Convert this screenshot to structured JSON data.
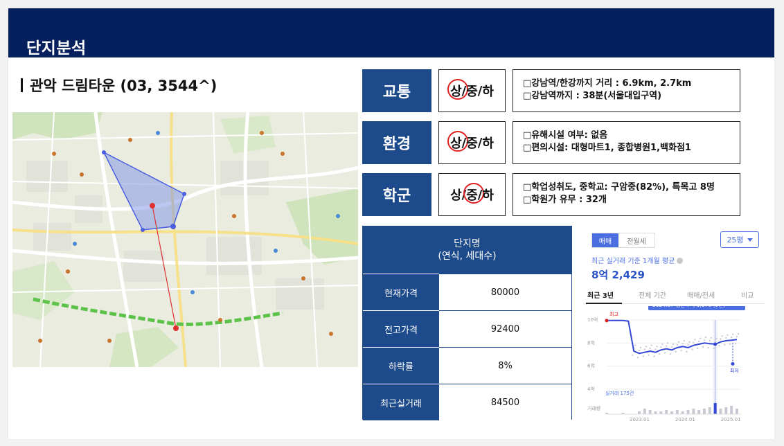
{
  "header": {
    "title": "단지분석"
  },
  "complex": {
    "title": "관악 드림타운 (03, 3544^)"
  },
  "analysis": [
    {
      "label": "교통",
      "grade": [
        "상",
        "/",
        "중",
        "/",
        "하"
      ],
      "selected": "상",
      "desc": [
        "□강남역/한강까지 거리 : 6.9km, 2.7km",
        "□강남역까지 : 38분(서울대입구역)"
      ]
    },
    {
      "label": "환경",
      "grade": [
        "상",
        "/",
        "중",
        "/",
        "하"
      ],
      "selected": "상",
      "desc": [
        "□유해시설 여부: 없음",
        "□편의시설: 대형마트1, 종합병원1,백화점1"
      ]
    },
    {
      "label": "학군",
      "grade": [
        "상",
        "/",
        "중",
        "/",
        "하"
      ],
      "selected": "중",
      "desc": [
        "□학업성취도, 중학교: 구암중(82%), 특목고 8명",
        "□학원가 유무 : 32개"
      ]
    }
  ],
  "table": {
    "header_line1": "단지명",
    "header_line2": "(연식, 세대수)",
    "rows": [
      {
        "key": "현재가격",
        "value": "80000"
      },
      {
        "key": "전고가격",
        "value": "92400"
      },
      {
        "key": "하락률",
        "value": "8%"
      },
      {
        "key": "최근실거래",
        "value": "84500"
      }
    ]
  },
  "widget": {
    "segment_on": "매매",
    "segment_off": "전월세",
    "size": "25평",
    "avg_label": "최근 실거래 기준 1개월 평균",
    "avg_value": "8억 2,429",
    "tabs": [
      "최근 3년",
      "전체 기간",
      "매매/전세",
      "비교"
    ],
    "active_tab": "최근 3년",
    "tooltip": "2024.07 평균 7억 9,078 (9건)",
    "y_labels": [
      "10억",
      "8억",
      "6억",
      "4억"
    ],
    "label_high": "최고",
    "label_low": "최저",
    "label_volume_count": "실거래 175건",
    "label_volume": "거래량",
    "x_labels": [
      "2023.01",
      "2024.01",
      "2025.01"
    ],
    "colors": {
      "line": "#3347d6",
      "accent": "#4a6ee0",
      "high": "#e0201e"
    }
  },
  "chart_data": {
    "type": "line",
    "title": "",
    "xlabel": "",
    "ylabel": "",
    "y_unit": "억",
    "ylim": [
      4,
      10
    ],
    "series": [
      {
        "values": [
          9.95,
          9.95,
          9.95,
          9.95,
          9.9,
          7.3,
          7.1,
          7.2,
          7.3,
          7.2,
          7.4,
          7.5,
          7.4,
          7.6,
          7.7,
          7.6,
          7.8,
          7.9,
          8.0,
          7.95,
          7.9,
          8.1,
          8.2,
          8.25,
          8.3
        ]
      }
    ],
    "volume": [
      1,
      0,
      0,
      1,
      0,
      0,
      2,
      4,
      3,
      2,
      2,
      3,
      2,
      3,
      2,
      3,
      4,
      3,
      4,
      5,
      8,
      4,
      5,
      6,
      4
    ],
    "highlight": {
      "label": "2024.07 평균 7억 9,078 (9건)",
      "value": 7.9
    },
    "legend": "none",
    "grid": true
  }
}
